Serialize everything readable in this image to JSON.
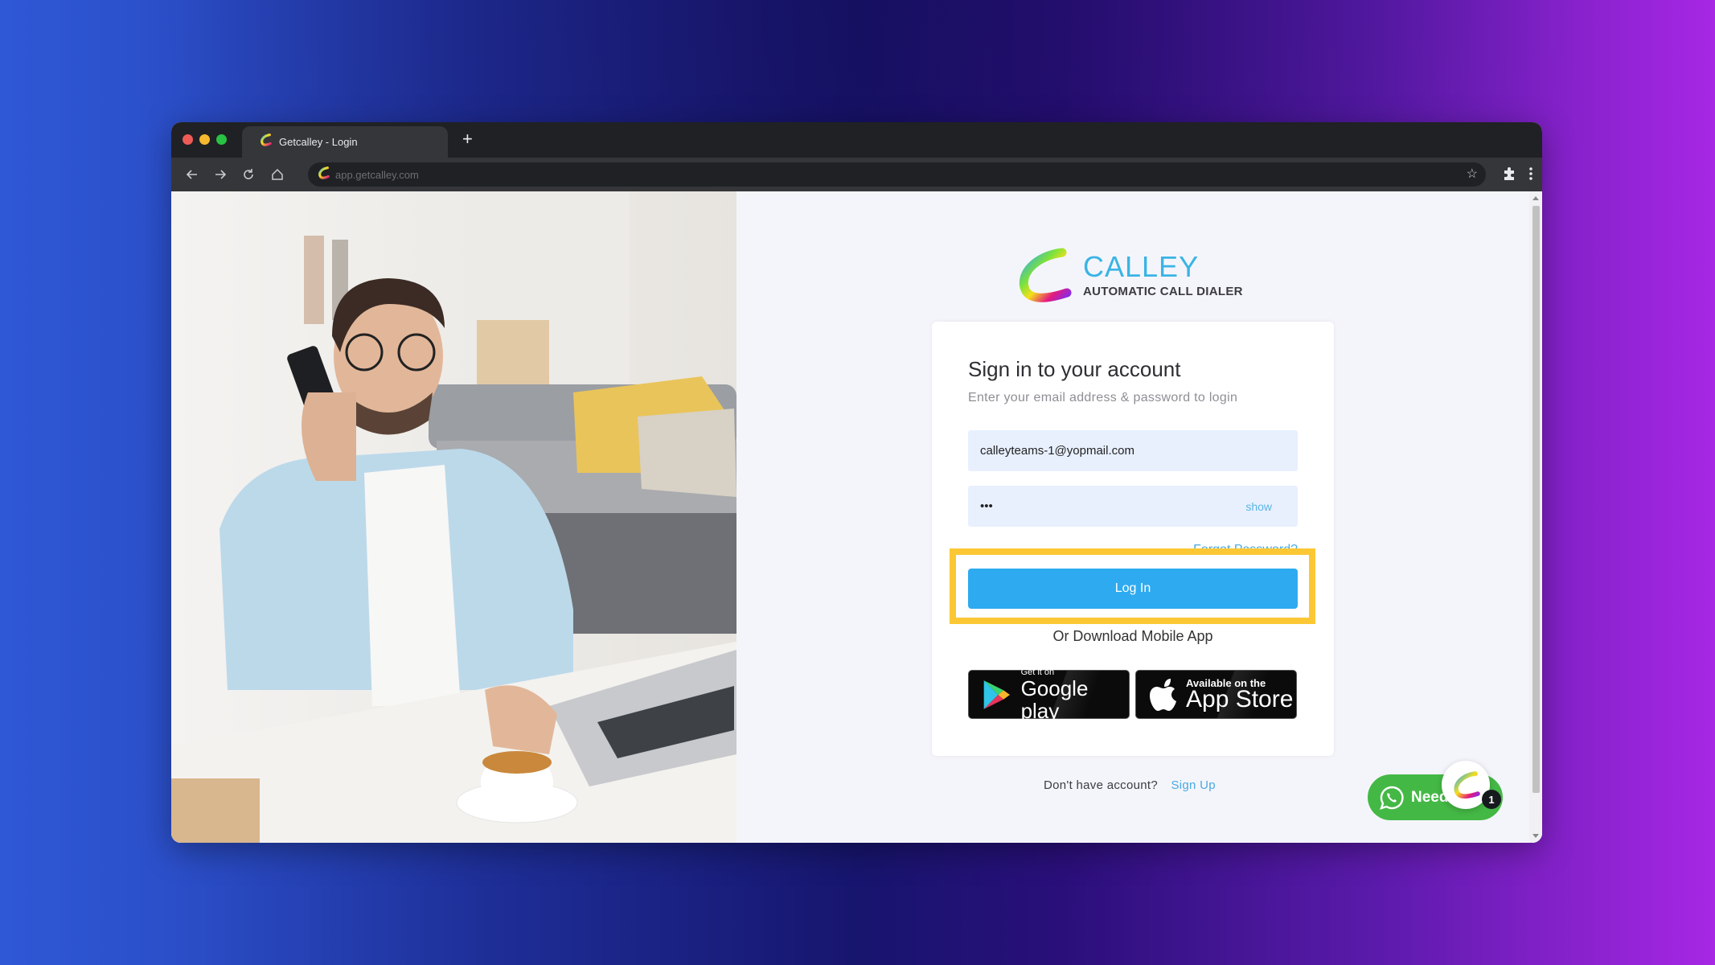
{
  "browser": {
    "tab_title": "Getcalley - Login",
    "new_tab_label": "+",
    "url": "app.getcalley.com"
  },
  "brand": {
    "name": "CALLEY",
    "tagline": "AUTOMATIC CALL DIALER",
    "color": "#3ab4e4"
  },
  "login": {
    "title": "Sign in to your account",
    "subtitle": "Enter your email address & password to login",
    "email_value": "calleyteams-1@yopmail.com",
    "password_value": "•••",
    "show_label": "show",
    "forgot_label": "Forgot Password?",
    "login_button": "Log In",
    "login_button_color": "#2eaaf0",
    "highlight_color": "#fbc734",
    "download_text": "Or Download Mobile App"
  },
  "stores": {
    "google": {
      "small": "Get it on",
      "big": "Google play"
    },
    "apple": {
      "small": "Available on the",
      "big": "App Store"
    }
  },
  "signup": {
    "prompt": "Don't have account?",
    "link": "Sign Up"
  },
  "whatsapp": {
    "label": "Need",
    "badge_count": "1",
    "color": "#44b845"
  }
}
